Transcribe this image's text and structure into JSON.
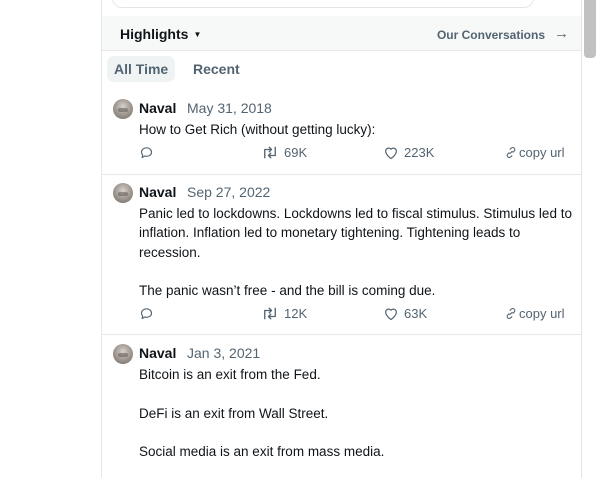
{
  "header": {
    "highlights_label": "Highlights",
    "caret": "▼",
    "conversations_label": "Our Conversations",
    "arrow": "→"
  },
  "tabs": [
    {
      "label": "All Time",
      "active": true
    },
    {
      "label": "Recent",
      "active": false
    }
  ],
  "tweets": [
    {
      "author": "Naval",
      "date": "May 31, 2018",
      "text": "How to Get Rich (without getting lucky):",
      "retweets": "69K",
      "likes": "223K",
      "copy_label": "copy url"
    },
    {
      "author": "Naval",
      "date": "Sep 27, 2022",
      "text": "Panic led to lockdowns. Lockdowns led to fiscal stimulus. Stimulus led to inflation. Inflation led to monetary tightening. Tightening leads to recession.\n\nThe panic wasn’t free - and the bill is coming due.",
      "retweets": "12K",
      "likes": "63K",
      "copy_label": "copy url"
    },
    {
      "author": "Naval",
      "date": "Jan 3, 2021",
      "text": "Bitcoin is an exit from the Fed.\n\nDeFi is an exit from Wall Street.\n\nSocial media is an exit from mass media.",
      "retweets": "",
      "likes": "",
      "copy_label": ""
    }
  ],
  "icons": {
    "reply": "reply-icon",
    "retweet": "retweet-icon",
    "like": "heart-icon",
    "link": "link-icon",
    "dropdown": "caret-down-icon",
    "arrow": "arrow-right-icon"
  },
  "colors": {
    "header_bg": "#f7f9f9",
    "muted_text": "#536471",
    "primary_text": "#0f1419",
    "border": "#e6e9ec",
    "active_tab_bg": "#eff3f4"
  }
}
